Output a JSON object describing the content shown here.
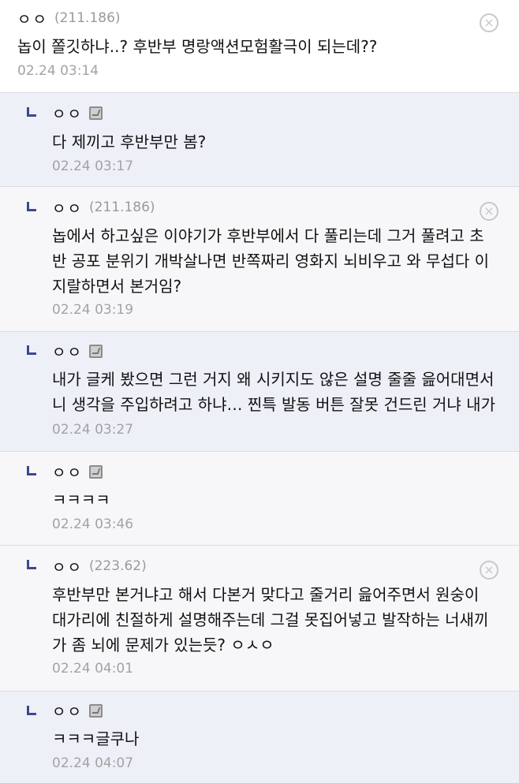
{
  "comments": [
    {
      "nick": "ㅇㅇ",
      "ip": "(211.186)",
      "text": "놉이 쫄깃하냐..? 후반부 명랑액션모험활극이 되는데??",
      "time": "02.24 03:14",
      "delete": "×"
    },
    {
      "nick": "ㅇㅇ",
      "text": "다 제끼고 후반부만 봄?",
      "time": "02.24 03:17"
    },
    {
      "nick": "ㅇㅇ",
      "ip": "(211.186)",
      "text": "놉에서 하고싶은 이야기가 후반부에서 다 풀리는데 그거 풀려고 초\n반 공포 분위기 개박살나면 반쪽짜리 영화지 뇌비우고 와 무섭다 이\n지랄하면서 본거임?",
      "time": "02.24 03:19",
      "delete": "×"
    },
    {
      "nick": "ㅇㅇ",
      "text": "내가 글케 봤으면 그런 거지 왜 시키지도 않은 설명 줄줄 읊어대면서\n니 생각을 주입하려고 하냐… 찐특 발동 버튼 잘못 건드린 거냐 내가",
      "time": "02.24 03:27"
    },
    {
      "nick": "ㅇㅇ",
      "text": "ㅋㅋㅋㅋ",
      "time": "02.24 03:46"
    },
    {
      "nick": "ㅇㅇ",
      "ip": "(223.62)",
      "text": "후반부만 본거냐고 해서 다본거 맞다고 줄거리 읊어주면서 원숭이\n대가리에 친절하게 설명해주는데 그걸 못집어넣고 발작하는 너새끼\n가 좀 뇌에 문제가 있는듯? ㅇㅅㅇ",
      "time": "02.24 04:01",
      "delete": "×"
    },
    {
      "nick": "ㅇㅇ",
      "text": "ㅋㅋㅋ글쿠나",
      "time": "02.24 04:07"
    }
  ]
}
